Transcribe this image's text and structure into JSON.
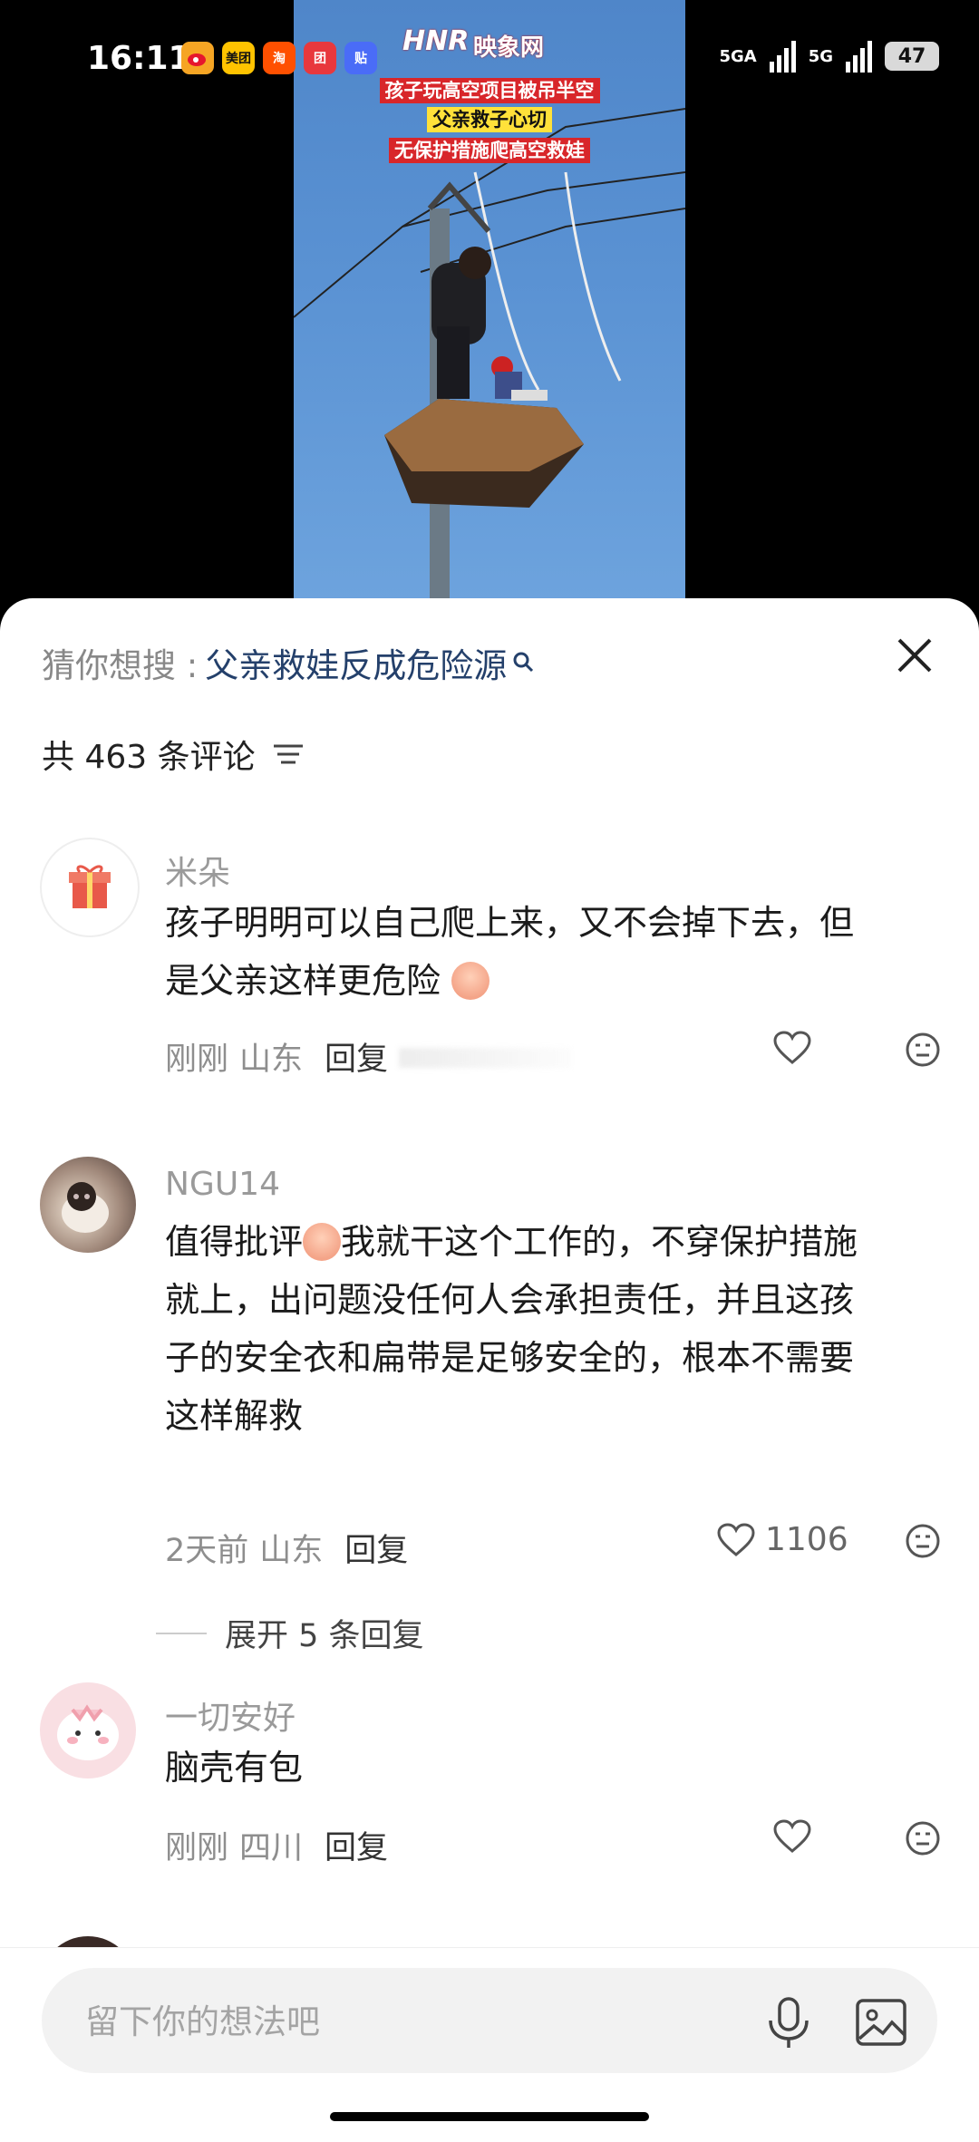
{
  "status_bar": {
    "time": "16:11",
    "apps": [
      {
        "icon": "weibo-icon",
        "label": "",
        "color": "#f6a524"
      },
      {
        "icon": "meituan-icon",
        "label": "美团",
        "color": "#ffc300"
      },
      {
        "icon": "taobao-icon",
        "label": "淘",
        "color": "#ff5000"
      },
      {
        "icon": "app-icon",
        "label": "团",
        "color": "#e8383d"
      },
      {
        "icon": "tieba-icon",
        "label": "贴",
        "color": "#4a6cf7"
      }
    ],
    "network1": "5GA",
    "network2": "5G",
    "battery": "47"
  },
  "video": {
    "logo_hnr": "HNR",
    "logo_site": "映象网",
    "headline_1": "孩子玩高空项目被吊半空",
    "headline_2": "父亲救子心切",
    "headline_3": "无保护措施爬高空救娃"
  },
  "sheet": {
    "search_prefix": "猜你想搜 :",
    "search_keyword": "父亲救娃反成危险源",
    "comment_count_label": "共 463 条评论",
    "comments": [
      {
        "username": "米朵",
        "text_1": "孩子明明可以自己爬上来，又不会掉下去，但",
        "text_2": "是父亲这样更危险",
        "time": "刚刚",
        "location": "山东",
        "reply": "回复",
        "likes": ""
      },
      {
        "username": "NGU14",
        "text_1": "值得批评",
        "text_2": "我就干这个工作的，不穿保护措施",
        "text_3": "就上，出问题没任何人会承担责任，并且这孩",
        "text_4": "子的安全衣和扁带是足够安全的，根本不需要",
        "text_5": "这样解救",
        "time": "2天前",
        "location": "山东",
        "reply": "回复",
        "likes": "1106",
        "expand_label": "展开 5 条回复"
      },
      {
        "username": "一切安好",
        "text_1": "脑壳有包",
        "time": "刚刚",
        "location": "四川",
        "reply": "回复",
        "likes": ""
      }
    ]
  },
  "input": {
    "placeholder": "留下你的想法吧"
  }
}
